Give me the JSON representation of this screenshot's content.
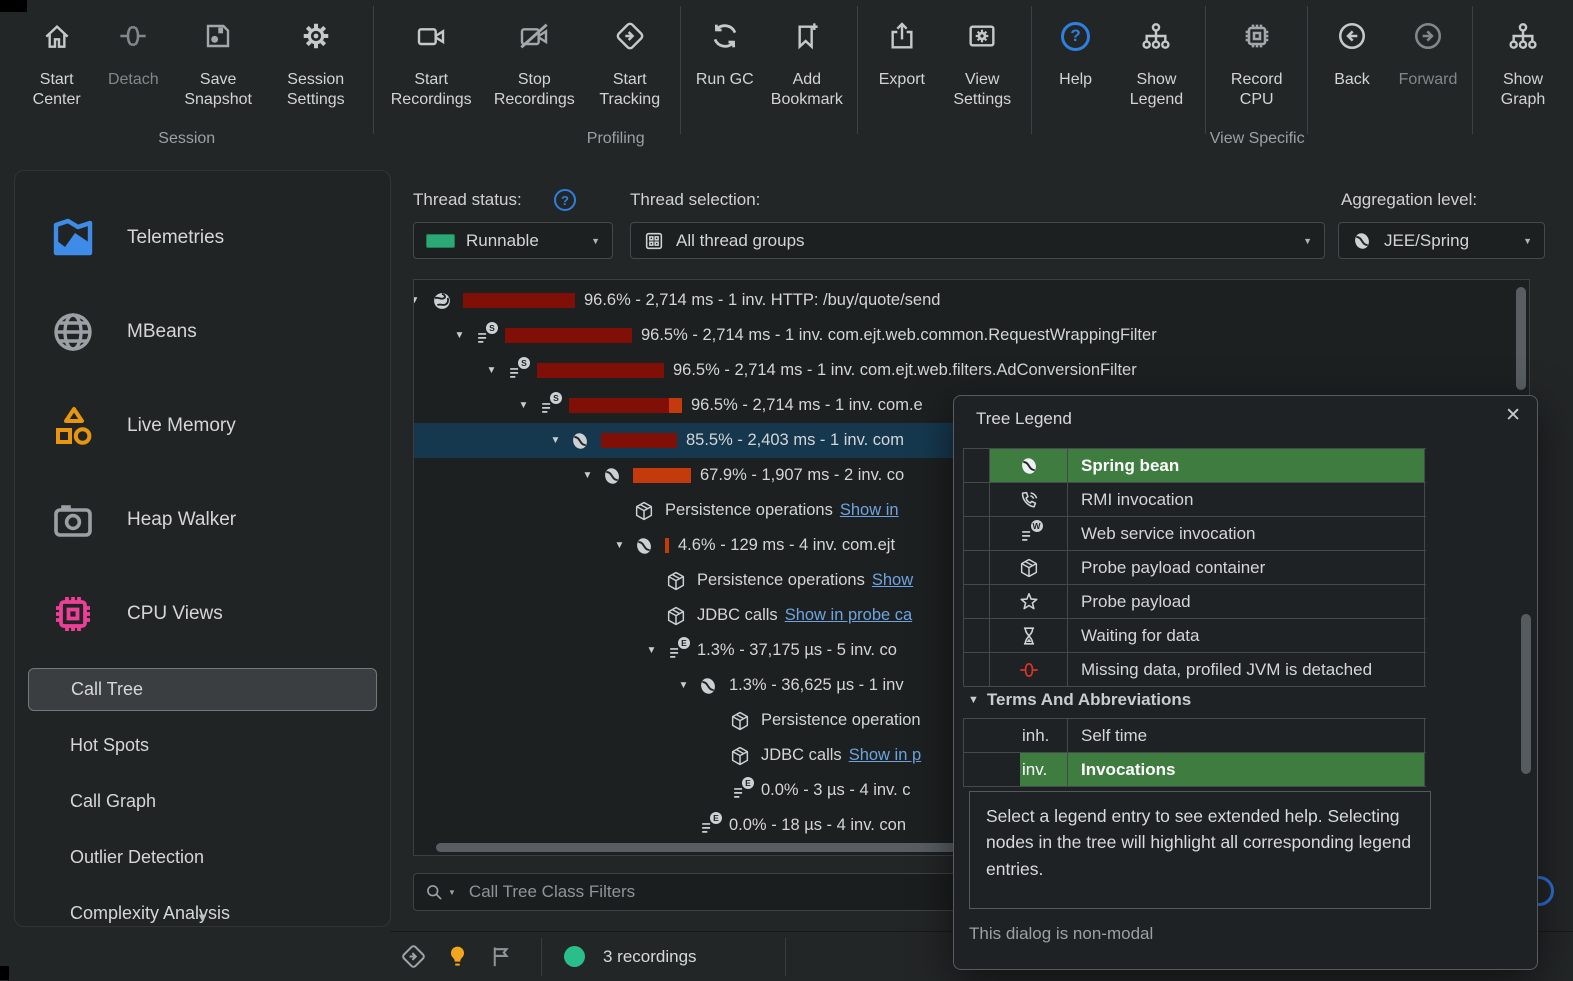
{
  "toolbar": {
    "sections": [
      {
        "caption": "Session",
        "groups": [
          [
            "Start Center",
            "Detach",
            "Save Snapshot",
            "Session Settings"
          ]
        ]
      },
      {
        "caption": "Profiling",
        "groups": [
          [
            "Start Recordings",
            "Stop Recordings",
            "Start Tracking"
          ],
          [
            "Run GC",
            "Add Bookmark"
          ]
        ]
      },
      {
        "caption": "",
        "groups": [
          [
            "Export",
            "View Settings"
          ]
        ]
      },
      {
        "caption": "",
        "groups": [
          [
            "Help",
            "Show Legend"
          ]
        ]
      },
      {
        "caption": "View Specific",
        "groups": [
          [
            "Record CPU"
          ]
        ]
      },
      {
        "caption": "",
        "groups": [
          [
            "Back",
            "Forward"
          ]
        ]
      },
      {
        "caption": "",
        "groups": [
          [
            "Show Graph"
          ]
        ]
      }
    ]
  },
  "sidebar": {
    "views": [
      {
        "label": "Telemetries"
      },
      {
        "label": "MBeans"
      },
      {
        "label": "Live Memory"
      },
      {
        "label": "Heap Walker"
      },
      {
        "label": "CPU Views"
      }
    ],
    "cpu_items": [
      {
        "label": "Call Tree",
        "selected": true
      },
      {
        "label": "Hot Spots"
      },
      {
        "label": "Call Graph"
      },
      {
        "label": "Outlier Detection"
      },
      {
        "label": "Complexity Analysis"
      }
    ]
  },
  "filters": {
    "thread_status_label": "Thread status:",
    "thread_status_value": "Runnable",
    "thread_selection_label": "Thread selection:",
    "thread_selection_value": "All thread groups",
    "aggregation_label": "Aggregation level:",
    "aggregation_value": "JEE/Spring"
  },
  "tree": {
    "rows": [
      {
        "text": "96.6% - 2,714 ms - 1 inv. HTTP: /buy/quote/send"
      },
      {
        "text": "96.5% - 2,714 ms - 1 inv. com.ejt.web.common.RequestWrappingFilter"
      },
      {
        "text": "96.5% - 2,714 ms - 1 inv. com.ejt.web.filters.AdConversionFilter"
      },
      {
        "text": "96.5% - 2,714 ms - 1 inv. com.e"
      },
      {
        "text": "85.5% - 2,403 ms - 1 inv. com"
      },
      {
        "text": "67.9% - 1,907 ms - 2 inv. co"
      },
      {
        "text": "Persistence operations",
        "link": "Show in"
      },
      {
        "text": "4.6% - 129 ms - 4 inv. com.ejt"
      },
      {
        "text": "Persistence operations",
        "link": "Show"
      },
      {
        "text": "JDBC calls",
        "link": "Show in probe ca"
      },
      {
        "text": "1.3% - 37,175 µs - 5 inv. co"
      },
      {
        "text": "1.3% - 36,625 µs - 1 inv"
      },
      {
        "text": "Persistence operation"
      },
      {
        "text": "JDBC calls",
        "link": "Show in p"
      },
      {
        "text": "0.0% - 3 µs - 4 inv. c"
      },
      {
        "text": "0.0% - 18 µs - 4 inv. con"
      }
    ]
  },
  "search": {
    "placeholder": "Call Tree Class Filters"
  },
  "legend": {
    "title": "Tree Legend",
    "rows": [
      {
        "label": "Spring bean",
        "highlighted": true
      },
      {
        "label": "RMI invocation"
      },
      {
        "label": "Web service invocation"
      },
      {
        "label": "Probe payload container"
      },
      {
        "label": "Probe payload"
      },
      {
        "label": "Waiting for data"
      },
      {
        "label": "Missing data, profiled JVM is detached"
      }
    ],
    "terms_header": "Terms And Abbreviations",
    "terms": [
      {
        "abbr": "inh.",
        "label": "Self time"
      },
      {
        "abbr": "inv.",
        "label": "Invocations",
        "highlighted": true
      }
    ],
    "help_text": "Select a legend entry to see extended help. Selecting nodes in the tree will highlight all corresponding legend entries.",
    "modal_note": "This dialog is non-modal"
  },
  "statusbar": {
    "recordings": "3 recordings"
  },
  "colors": {
    "accent_green": "#3e7c40",
    "selection_blue": "#16384e",
    "bar_dark_red": "#800f08",
    "bar_orange": "#c43a0c",
    "help_blue": "#2f7fe0",
    "status_green": "#2abf8a",
    "bulb_orange": "#f2a51d",
    "telemetry_blue": "#3f8ce8",
    "live_memory_orange": "#e8950f",
    "cpu_pink": "#ed3f98"
  }
}
